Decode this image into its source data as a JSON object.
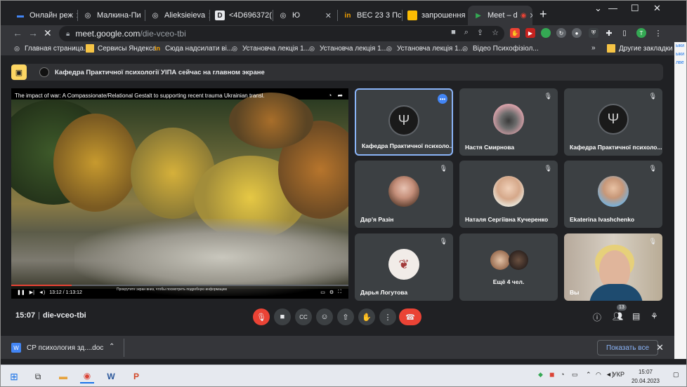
{
  "tabs": [
    {
      "title": "Онлайн реж",
      "icon": "meet-icon"
    },
    {
      "title": "Малкина-Пи",
      "icon": "globe-icon"
    },
    {
      "title": "Alieksieieva",
      "icon": "globe-icon"
    },
    {
      "title": "<4D696372(",
      "icon": "d-icon"
    },
    {
      "title": "Ю",
      "icon": "globe-icon"
    },
    {
      "title": "BEC 23 3 Пс",
      "icon": "in-icon"
    },
    {
      "title": "запрошення",
      "icon": "slides-icon"
    },
    {
      "title": "Meet – d",
      "icon": "meet-icon"
    }
  ],
  "window": {
    "minimize": "—",
    "maximize": "☐",
    "close": "✕"
  },
  "address": {
    "host": "meet.google.com",
    "path": "/die-vceo-tbi"
  },
  "bookmarks": [
    {
      "label": "Главная страница...",
      "icon": "yandex-icon"
    },
    {
      "label": "Сервисы Яндекса",
      "icon": "folder-icon"
    },
    {
      "label": "Сюда надсилати ві...",
      "icon": "brand-icon"
    },
    {
      "label": "Установча лекція 1...",
      "icon": "globe-icon"
    },
    {
      "label": "Установча лекція 1...",
      "icon": "globe-icon"
    },
    {
      "label": "Установча лекція 1...",
      "icon": "globe-icon"
    },
    {
      "label": "Відео Психофізіол...",
      "icon": "globe-icon"
    },
    {
      "label": "»",
      "icon": ""
    },
    {
      "label": "Другие закладки",
      "icon": "folder-icon"
    }
  ],
  "side_strip": {
    "labels": [
      "ыки",
      "ыки",
      "лве"
    ]
  },
  "meet": {
    "banner": "Кафедра Практичної психології УІПА сейчас на главном экране",
    "presentation": {
      "title": "The impact of war: A Compassionate/Relational Gestalt to supporting recent trauma Ukrainian transl.",
      "time": "13:12 / 1:13:12",
      "hint": "Прокрутите экран вниз, чтобы посмотреть подробную информацию",
      "progress": 0.18
    },
    "tiles": [
      {
        "name": "Кафедра Практичної психоло...",
        "avatar": "logo",
        "selected": true
      },
      {
        "name": "Настя Смирнова",
        "avatar": "raccoon"
      },
      {
        "name": "Кафедра Практичної психоло...",
        "avatar": "logo"
      },
      {
        "name": "Дар'я Разін",
        "avatar": "photo"
      },
      {
        "name": "Наталя Сергіївна Кучеренко",
        "avatar": "photo"
      },
      {
        "name": "Ekaterina Ivashchenko",
        "avatar": "photo"
      },
      {
        "name": "Дарья Логутова",
        "avatar": "drawn"
      },
      {
        "name": "Ещё 4 чел.",
        "avatar": "group"
      },
      {
        "name": "Вы",
        "avatar": "self"
      }
    ],
    "time": "15:07",
    "code": "die-vceo-tbi",
    "participants_count": "13"
  },
  "download": {
    "file": "СР психология зд....doc",
    "show_all": "Показать все"
  },
  "taskbar": {
    "lang": "УКР",
    "time": "15:07",
    "date": "20.04.2023"
  }
}
